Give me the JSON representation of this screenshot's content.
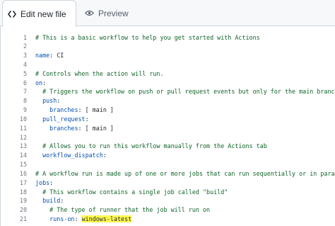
{
  "tabs": {
    "edit_label": "Edit new file",
    "preview_label": "Preview"
  },
  "icons": {
    "edit": "code-brackets-icon",
    "preview": "eye-icon"
  },
  "colors": {
    "comment": "#116329",
    "key": "#0550ae",
    "highlight": "#fff84f"
  },
  "editor": {
    "lines": [
      {
        "n": "1",
        "t": "# This is a basic workflow to help you get started with Actions"
      },
      {
        "n": "2",
        "t": ""
      },
      {
        "n": "3",
        "t": "name: CI"
      },
      {
        "n": "4",
        "t": ""
      },
      {
        "n": "5",
        "t": "# Controls when the action will run."
      },
      {
        "n": "6",
        "t": "on:"
      },
      {
        "n": "7",
        "t": "  # Triggers the workflow on push or pull request events but only for the main branch"
      },
      {
        "n": "8",
        "t": "  push:"
      },
      {
        "n": "9",
        "t": "    branches: [ main ]"
      },
      {
        "n": "10",
        "t": "  pull_request:"
      },
      {
        "n": "11",
        "t": "    branches: [ main ]"
      },
      {
        "n": "12",
        "t": ""
      },
      {
        "n": "13",
        "t": "  # Allows you to run this workflow manually from the Actions tab"
      },
      {
        "n": "14",
        "t": "  workflow_dispatch:"
      },
      {
        "n": "15",
        "t": ""
      },
      {
        "n": "16",
        "t": "# A workflow run is made up of one or more jobs that can run sequentially or in parallel"
      },
      {
        "n": "17",
        "t": "jobs:"
      },
      {
        "n": "18",
        "t": "  # This workflow contains a single job called \"build\""
      },
      {
        "n": "19",
        "t": "  build:"
      },
      {
        "n": "20",
        "t": "    # The type of runner that the job will run on"
      },
      {
        "n": "21",
        "t": "    runs-on: windows-latest"
      }
    ]
  }
}
